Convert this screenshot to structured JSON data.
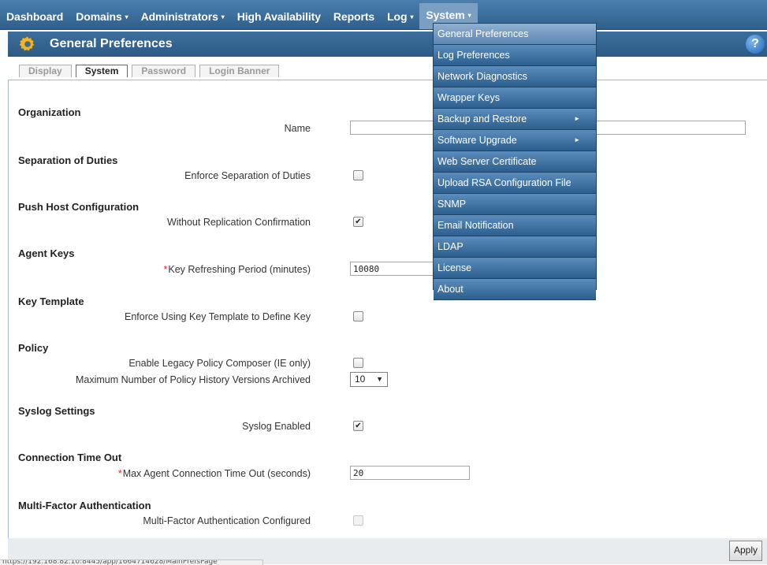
{
  "nav": {
    "items": [
      {
        "label": "Dashboard",
        "caret": false
      },
      {
        "label": "Domains",
        "caret": true
      },
      {
        "label": "Administrators",
        "caret": true
      },
      {
        "label": "High Availability",
        "caret": false
      },
      {
        "label": "Reports",
        "caret": false
      },
      {
        "label": "Log",
        "caret": true
      },
      {
        "label": "System",
        "caret": true
      }
    ],
    "caret_glyph": "▾"
  },
  "page": {
    "title": "General Preferences",
    "help_glyph": "?"
  },
  "tabs": [
    "Display",
    "System",
    "Password",
    "Login Banner"
  ],
  "sections": {
    "organization": {
      "title": "Organization",
      "name_label": "Name",
      "name_value": ""
    },
    "separation": {
      "title": "Separation of Duties",
      "enforce_label": "Enforce Separation of Duties",
      "enforce_checked": false
    },
    "push_host": {
      "title": "Push Host Configuration",
      "without_label": "Without Replication Confirmation",
      "without_checked": true
    },
    "agent_keys": {
      "title": "Agent Keys",
      "refresh_label": "Key Refreshing Period (minutes)",
      "refresh_value": "10080"
    },
    "key_template": {
      "title": "Key Template",
      "enforce_label": "Enforce Using Key Template to Define Key",
      "enforce_checked": false
    },
    "policy": {
      "title": "Policy",
      "legacy_label": "Enable Legacy Policy Composer (IE only)",
      "legacy_checked": false,
      "history_label": "Maximum Number of Policy History Versions Archived",
      "history_value": "10"
    },
    "syslog": {
      "title": "Syslog Settings",
      "enabled_label": "Syslog Enabled",
      "enabled_checked": true
    },
    "connection": {
      "title": "Connection Time Out",
      "max_label": "Max Agent Connection Time Out (seconds)",
      "max_value": "20"
    },
    "mfa": {
      "title": "Multi-Factor Authentication",
      "configured_label": "Multi-Factor Authentication Configured",
      "configured_checked": false
    }
  },
  "required_marker": "*",
  "check_glyph": "✔",
  "select_arrow": "▼",
  "submenu_glyph": "►",
  "footer": {
    "apply_label": "Apply"
  },
  "status_url": "https://192.168.82.10:8445/app/1664714628/MainPrefsPage",
  "system_menu": [
    {
      "label": "General Preferences",
      "submenu": false,
      "highlight": true
    },
    {
      "label": "Log Preferences",
      "submenu": false
    },
    {
      "label": "Network Diagnostics",
      "submenu": false
    },
    {
      "label": "Wrapper Keys",
      "submenu": false
    },
    {
      "label": "Backup and Restore",
      "submenu": true
    },
    {
      "label": "Software Upgrade",
      "submenu": true
    },
    {
      "label": "Web Server Certificate",
      "submenu": false
    },
    {
      "label": "Upload RSA Configuration File",
      "submenu": false
    },
    {
      "label": "SNMP",
      "submenu": false
    },
    {
      "label": "Email Notification",
      "submenu": false
    },
    {
      "label": "LDAP",
      "submenu": false
    },
    {
      "label": "License",
      "submenu": false
    },
    {
      "label": "About",
      "submenu": false
    }
  ],
  "colors": {
    "nav_bg": "#3a6b98",
    "menu_bg": "#2c5f8e",
    "menu_highlight": "#7a9fc2",
    "required": "#dd2222"
  }
}
